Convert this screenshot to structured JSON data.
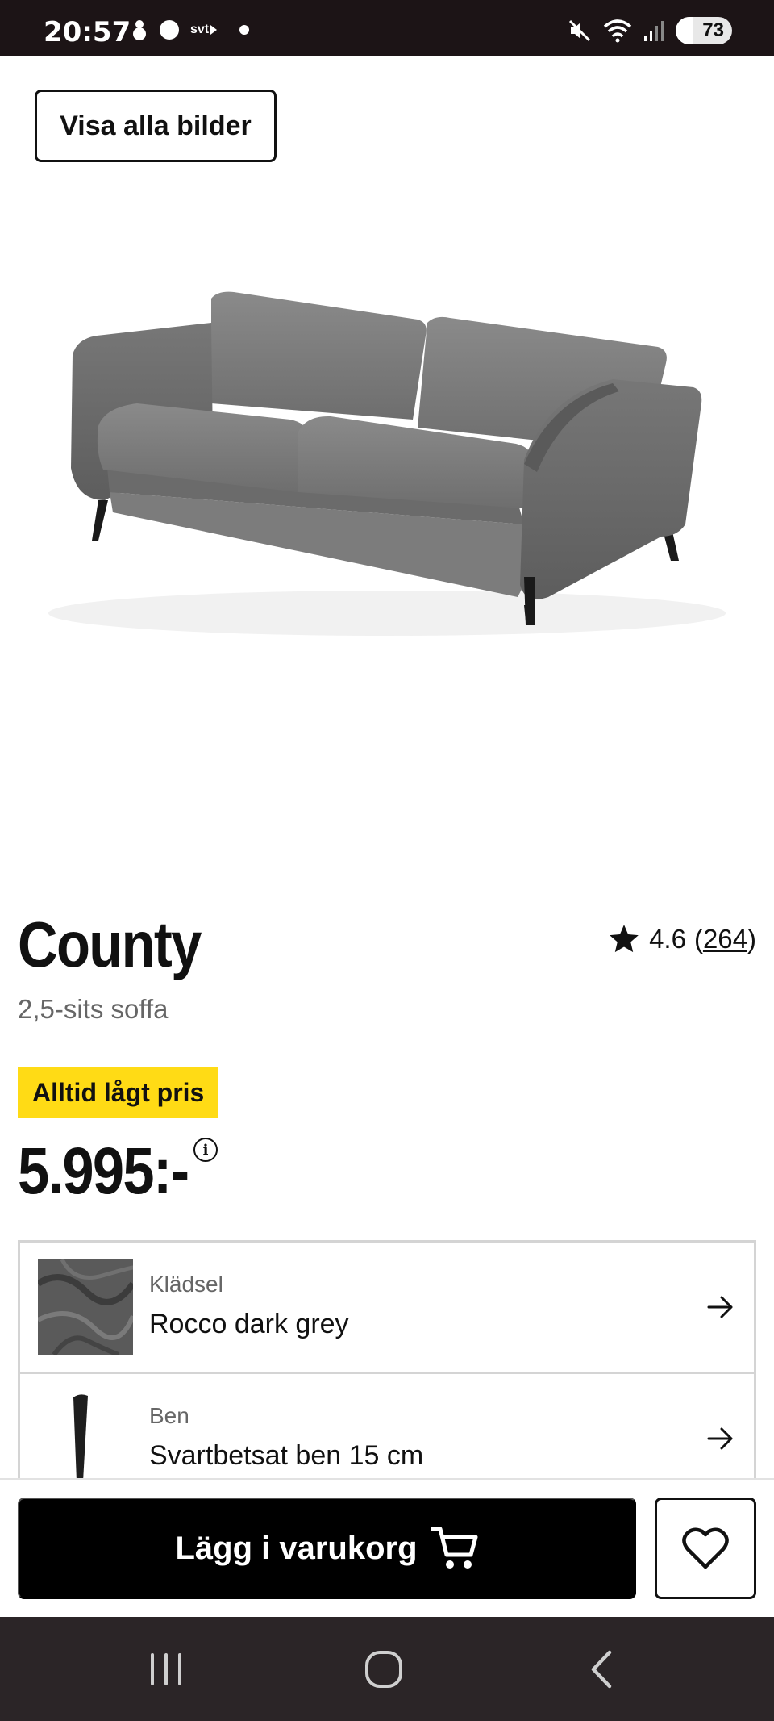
{
  "status_bar": {
    "time": "20:57",
    "svt_label": "svt",
    "battery": "73",
    "icons": [
      "snowman-icon",
      "record-dot-icon",
      "svt-play-icon",
      "notification-dot-icon",
      "mute-icon",
      "wifi-icon",
      "signal-icon",
      "battery-saver-icon"
    ]
  },
  "gallery": {
    "button_label": "Visa alla bilder"
  },
  "product": {
    "title": "County",
    "subtitle": "2,5-sits soffa",
    "rating_value": "4.6",
    "rating_open": "(",
    "rating_count": "264",
    "rating_close": ")",
    "badge": "Alltid lågt pris",
    "price": "5.995:-",
    "info_symbol": "i"
  },
  "options": [
    {
      "label": "Klädsel",
      "value": "Rocco dark grey"
    },
    {
      "label": "Ben",
      "value": "Svartbetsat ben 15 cm"
    }
  ],
  "actions": {
    "add_to_cart_label": "Lägg i varukorg"
  },
  "colors": {
    "badge_yellow": "#ffdb15",
    "button_black": "#000000",
    "status_bar_bg": "#1c1416",
    "nav_bar_bg": "#2b2527"
  }
}
